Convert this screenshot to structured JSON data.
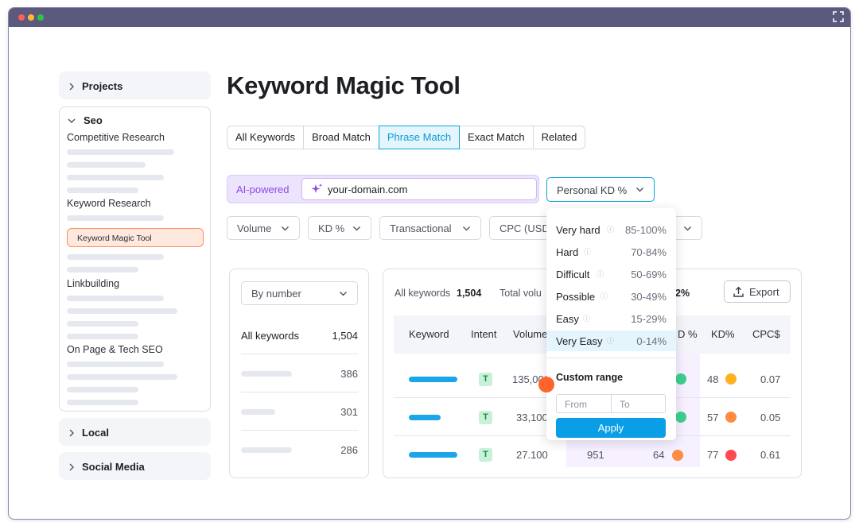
{
  "window": {
    "dot_colors": [
      "#ff5f57",
      "#febc2e",
      "#28c840"
    ],
    "expand_icon": "expand-icon"
  },
  "sidebar": {
    "projects": "Projects",
    "seo": "Seo",
    "seo_items": [
      "Competitive Research",
      "Keyword Research",
      "Keyword Magic Tool",
      "Linkbuilding",
      "On Page & Tech SEO"
    ],
    "local": "Local",
    "social_media": "Social Media"
  },
  "page_title": "Keyword Magic Tool",
  "tabs": [
    "All Keywords",
    "Broad Match",
    "Phrase Match",
    "Exact Match",
    "Related"
  ],
  "active_tab": "Phrase Match",
  "ai_search": {
    "label": "AI-powered",
    "value": "your-domain.com"
  },
  "kd_select": "Personal KD %",
  "filters": [
    "Volume",
    "KD %",
    "Transactional",
    "CPC (USD"
  ],
  "left_panel": {
    "select": "By number",
    "all_label": "All keywords",
    "all_count": "1,504",
    "counts": [
      "386",
      "301",
      "286"
    ]
  },
  "right_panel": {
    "all_keywords_label": "All keywords",
    "all_keywords_count": "1,504",
    "total_volume_label": "Total volu",
    "partial_value": "2%",
    "export_label": "Export",
    "columns": [
      "Keyword",
      "Intent",
      "Volume",
      "D %",
      "KD%",
      "CPC$"
    ],
    "rows": [
      {
        "intent": "T",
        "volume": "135,000",
        "trend": "",
        "pkd": "",
        "kd": "48",
        "kd_color": "#ffb21f",
        "cpc": "0.07"
      },
      {
        "intent": "T",
        "volume": "33,100",
        "trend": "",
        "pkd": "",
        "kd": "57",
        "kd_color": "#ff8c40",
        "cpc": "0.05"
      },
      {
        "intent": "T",
        "volume": "27.100",
        "trend": "951",
        "pkd": "64",
        "kd": "77",
        "kd_color": "#ff4953",
        "cpc": "0.61"
      }
    ]
  },
  "kd_dropdown": {
    "options": [
      {
        "label": "Very hard",
        "range": "85-100%"
      },
      {
        "label": "Hard",
        "range": "70-84%"
      },
      {
        "label": "Difficult",
        "range": "50-69%"
      },
      {
        "label": "Possible",
        "range": "30-49%"
      },
      {
        "label": "Easy",
        "range": "15-29%"
      },
      {
        "label": "Very Easy",
        "range": "0-14%"
      }
    ],
    "active": "Very Easy",
    "custom_range_title": "Custom range",
    "from_placeholder": "From",
    "to_placeholder": "To",
    "apply_label": "Apply"
  }
}
